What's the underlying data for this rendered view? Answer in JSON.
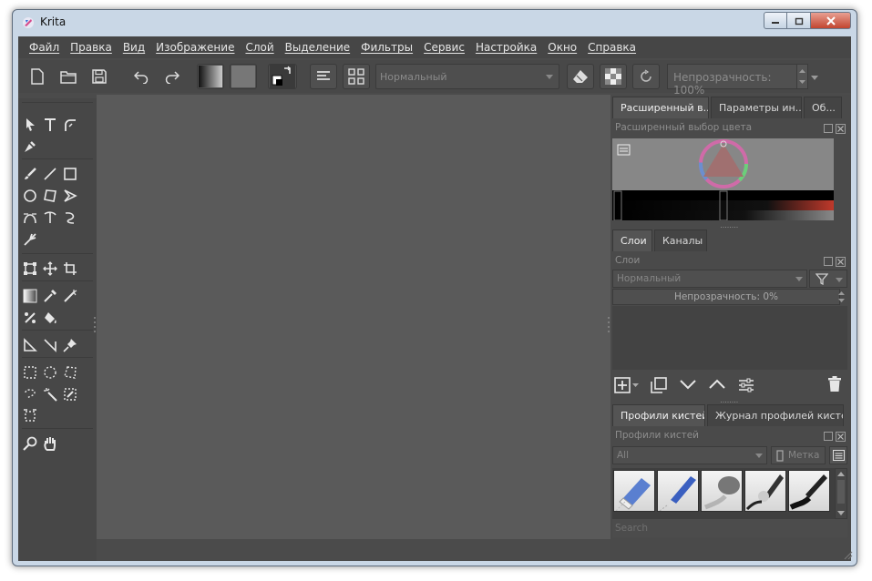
{
  "window": {
    "title": "Krita"
  },
  "menu": [
    "Файл",
    "Правка",
    "Вид",
    "Изображение",
    "Слой",
    "Выделение",
    "Фильтры",
    "Сервис",
    "Настройка",
    "Окно",
    "Справка"
  ],
  "toolbar": {
    "blend_mode": "Нормальный",
    "opacity": "Непрозрачность:  100%"
  },
  "dock": {
    "top_tabs": [
      "Расширенный в...",
      "Параметры ин...",
      "Об..."
    ],
    "color_panel_title": "Расширенный выбор цвета",
    "layer_tabs": [
      "Слои",
      "Каналы"
    ],
    "layers_panel_title": "Слои",
    "layer_blend_mode": "Нормальный",
    "layer_opacity": "Непрозрачность:  0%",
    "brush_tabs": [
      "Профили кистей",
      "Журнал профилей кистей"
    ],
    "brush_panel_title": "Профили кистей",
    "brush_filter": "All",
    "tag_label": "Метка",
    "search_placeholder": "Search"
  },
  "colors": {
    "accent_red": "#c0392b",
    "ui_dark": "#4b4b4b",
    "canvas": "#5a5a5a"
  }
}
